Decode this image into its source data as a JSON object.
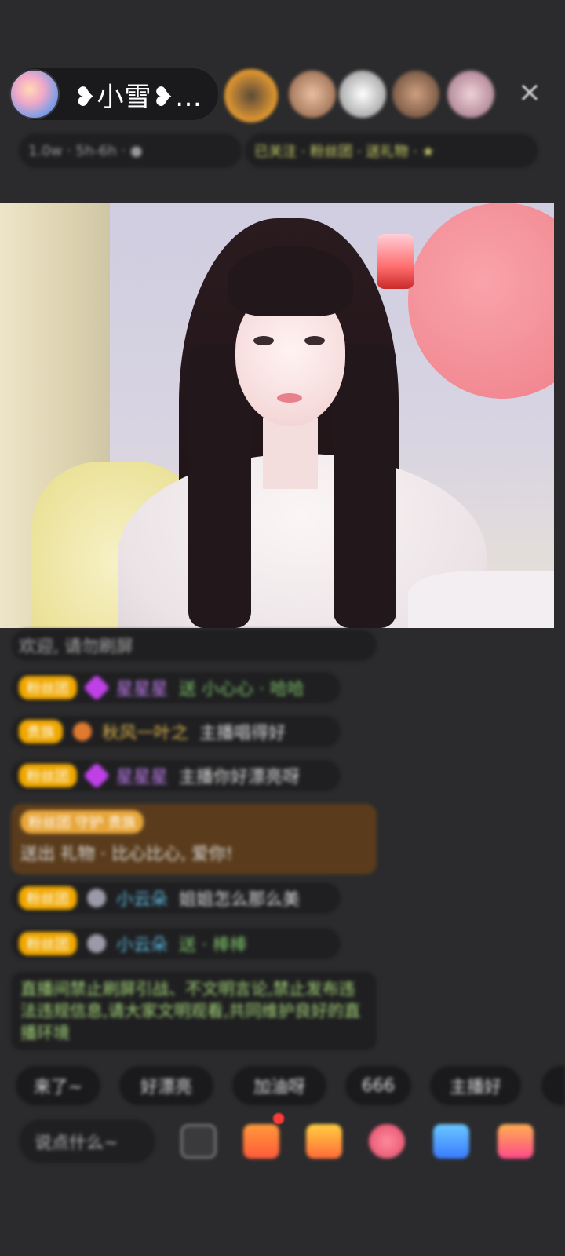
{
  "header": {
    "host_name": "❥小雪❥…",
    "close_icon": "×"
  },
  "info_bar": {
    "left_text": "1.0w · 5h-6h · ●",
    "right_text": "已关注 · 粉丝团 · 送礼物 · ★"
  },
  "chat": {
    "pinned": "欢迎,  请勿刷屏",
    "messages": [
      {
        "badge": "粉丝团",
        "name": "星星星",
        "text": "送 小心心 · 哈哈"
      },
      {
        "badge": "贵族",
        "name": "秋风一叶之",
        "text": "主播唱得好"
      },
      {
        "badge": "粉丝团",
        "name": "星星星",
        "text": "主播你好漂亮呀"
      },
      {
        "badge": "粉丝团",
        "name": "小云朵",
        "text": "姐姐怎么那么美"
      },
      {
        "badge": "粉丝团",
        "name": "小云朵",
        "text": "送 · 棒棒"
      }
    ],
    "gift": {
      "badges": "粉丝团  守护  贵族",
      "text": "送出 礼物 · 比心比心,  爱你!"
    },
    "system": "直播间禁止刷屏引战、不文明言论,禁止发布违法违规信息,请大家文明观看,共同维护良好的直播环境"
  },
  "quick_replies": [
    "来了~",
    "好漂亮",
    "加油呀",
    "666",
    "主播好"
  ],
  "bottom": {
    "input_placeholder": "说点什么~",
    "tools": [
      "emoji-icon",
      "gift-box-icon",
      "treasure-icon",
      "heart-icon",
      "game-icon",
      "more-icon"
    ]
  },
  "colors": {
    "background": "#2b2b2d",
    "badge_gold": "#f0a800",
    "name_purple": "#c07cf0",
    "name_gold": "#e2b84a",
    "name_cyan": "#5fc2e8",
    "system_green": "#a8d97a"
  }
}
